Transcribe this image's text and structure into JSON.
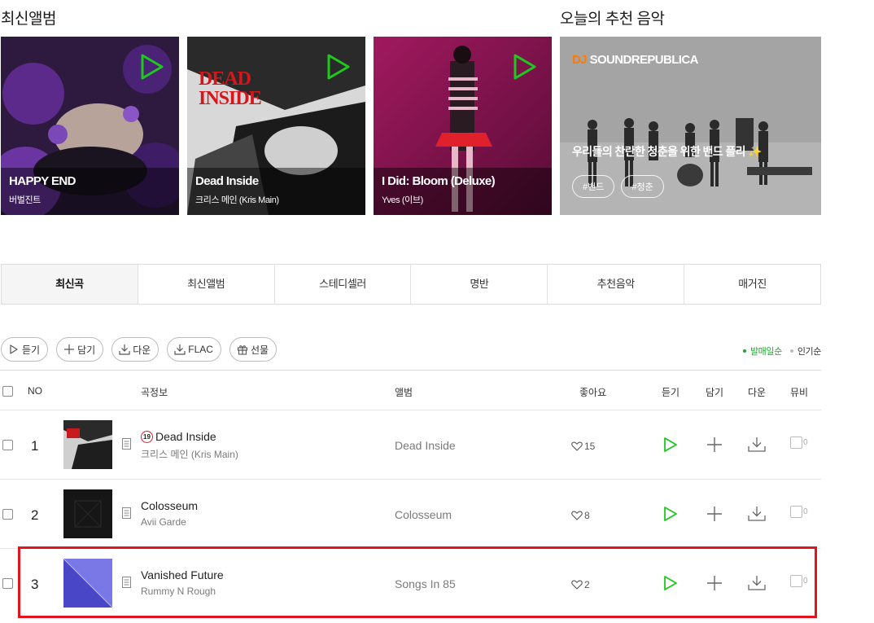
{
  "sections": {
    "new_albums_title": "최신앨범",
    "recommend_title": "오늘의 추천 음악"
  },
  "albums": [
    {
      "title": "HAPPY END",
      "artist": "버벌진트"
    },
    {
      "title": "Dead Inside",
      "artist": "크리스 메인 (Kris Main)"
    },
    {
      "title": "I Did: Bloom (Deluxe)",
      "artist": "Yves (이브)"
    }
  ],
  "dj": {
    "prefix": "DJ",
    "name": "SOUNDREPUBLICA",
    "description": "우리들의 찬란한 청춘을 위한 밴드 플리 ✨",
    "tags": [
      "#밴드",
      "#청춘"
    ]
  },
  "tabs": [
    "최신곡",
    "최신앨범",
    "스테디셀러",
    "명반",
    "추천음악",
    "매거진"
  ],
  "actions": {
    "listen": "듣기",
    "add": "담기",
    "download": "다운",
    "flac": "FLAC",
    "gift": "선물"
  },
  "sort": {
    "release": "발매일순",
    "popular": "인기순"
  },
  "headers": {
    "no": "NO",
    "song_info": "곡정보",
    "album": "앨범",
    "likes": "좋아요",
    "listen": "듣기",
    "add": "담기",
    "download": "다운",
    "mv": "뮤비"
  },
  "songs": [
    {
      "no": "1",
      "title": "Dead Inside",
      "artist": "크리스 메인 (Kris Main)",
      "album": "Dead Inside",
      "likes": "15",
      "age_badge": "19",
      "mv_count": "0"
    },
    {
      "no": "2",
      "title": "Colosseum",
      "artist": "Avii Garde",
      "album": "Colosseum",
      "likes": "8",
      "mv_count": "0"
    },
    {
      "no": "3",
      "title": "Vanished Future",
      "artist": "Rummy N Rough",
      "album": "Songs In 85",
      "likes": "2",
      "mv_count": "0"
    }
  ],
  "colors": {
    "accent_green": "#1ca82c",
    "highlight_red": "#e3141b",
    "dj_orange": "#ff7a00"
  }
}
